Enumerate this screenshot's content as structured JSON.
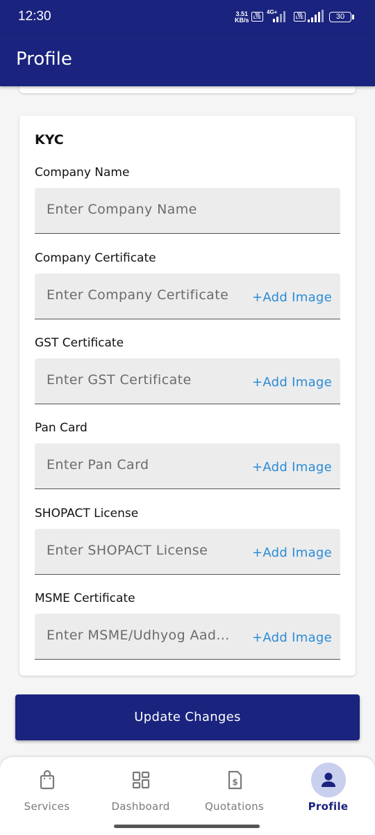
{
  "status_bar": {
    "time": "12:30",
    "speed_value": "3.51",
    "speed_unit": "KB/s",
    "volte1": "Vo LTE",
    "network": "4G+",
    "volte2": "Vo LTE",
    "battery": "30"
  },
  "app_bar": {
    "title": "Profile"
  },
  "kyc": {
    "title": "KYC",
    "fields": [
      {
        "label": "Company Name",
        "placeholder": "Enter Company Name",
        "add_image": ""
      },
      {
        "label": "Company Certificate",
        "placeholder": "Enter Company Certificate",
        "add_image": "+Add Image"
      },
      {
        "label": "GST Certificate",
        "placeholder": "Enter GST Certificate",
        "add_image": "+Add Image"
      },
      {
        "label": "Pan Card",
        "placeholder": "Enter Pan Card",
        "add_image": "+Add Image"
      },
      {
        "label": "SHOPACT License",
        "placeholder": "Enter SHOPACT License",
        "add_image": "+Add Image"
      },
      {
        "label": "MSME Certificate",
        "placeholder": "Enter MSME/Udhyog Aad...",
        "add_image": "+Add Image"
      }
    ]
  },
  "update_button": "Update Changes",
  "bottom_nav": {
    "items": [
      {
        "label": "Services",
        "icon": "shopping-bag-icon"
      },
      {
        "label": "Dashboard",
        "icon": "dashboard-icon"
      },
      {
        "label": "Quotations",
        "icon": "invoice-icon"
      },
      {
        "label": "Profile",
        "icon": "person-icon"
      }
    ],
    "active": "Profile"
  },
  "colors": {
    "primary": "#1a237e",
    "link": "#2a8bd6",
    "field_bg": "#ececec",
    "active_pill": "#c9cfee"
  }
}
